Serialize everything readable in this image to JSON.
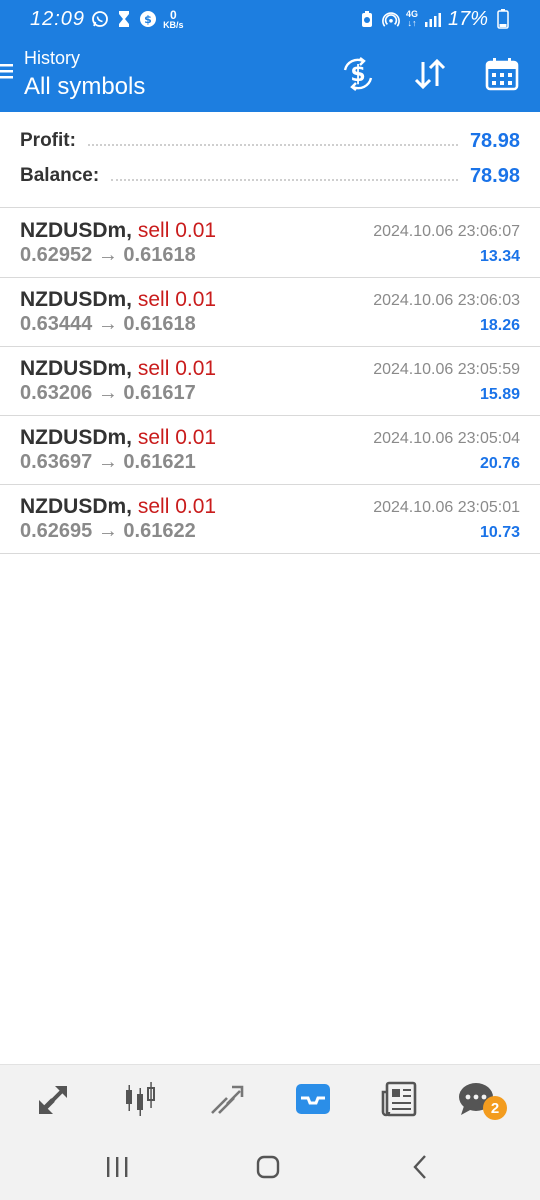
{
  "status_bar": {
    "time": "12:09",
    "speed_value": "0",
    "speed_unit": "KB/s",
    "network": "4G",
    "battery": "17%"
  },
  "header": {
    "subtitle": "History",
    "title": "All symbols"
  },
  "summary": {
    "profit_label": "Profit:",
    "profit_value": "78.98",
    "balance_label": "Balance:",
    "balance_value": "78.98"
  },
  "deals": [
    {
      "symbol": "NZDUSDm",
      "type": "sell 0.01",
      "prices": "0.62952 → 0.61618",
      "time": "2024.10.06 23:06:07",
      "profit": "13.34"
    },
    {
      "symbol": "NZDUSDm",
      "type": "sell 0.01",
      "prices": "0.63444 → 0.61618",
      "time": "2024.10.06 23:06:03",
      "profit": "18.26"
    },
    {
      "symbol": "NZDUSDm",
      "type": "sell 0.01",
      "prices": "0.63206 → 0.61617",
      "time": "2024.10.06 23:05:59",
      "profit": "15.89"
    },
    {
      "symbol": "NZDUSDm",
      "type": "sell 0.01",
      "prices": "0.63697 → 0.61621",
      "time": "2024.10.06 23:05:04",
      "profit": "20.76"
    },
    {
      "symbol": "NZDUSDm",
      "type": "sell 0.01",
      "prices": "0.62695 → 0.61622",
      "time": "2024.10.06 23:05:01",
      "profit": "10.73"
    }
  ],
  "bottom_nav": {
    "chat_badge": "2"
  },
  "colors": {
    "header": "#1d7ee0",
    "profit_blue": "#1a73e8",
    "sell_red": "#c91c1c",
    "active_tab": "#2b8ee8",
    "badge": "#f39c1f"
  }
}
